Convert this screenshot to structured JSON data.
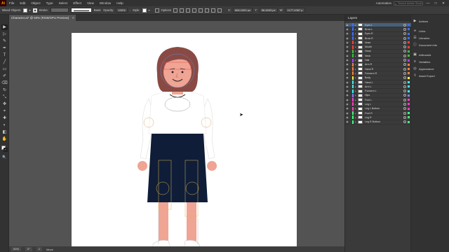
{
  "app": {
    "logo": "Ai"
  },
  "menu": [
    "File",
    "Edit",
    "Object",
    "Type",
    "Select",
    "Effect",
    "View",
    "Window",
    "Help"
  ],
  "menubar_right": {
    "workspace": "Automation",
    "search_placeholder": "Search Adobe Stock",
    "window_buttons": [
      "—",
      "□",
      "✕"
    ]
  },
  "control_bar": {
    "selection_label": "Mixed Objects",
    "stroke_label": "Stroke:",
    "brush_label": "Basic",
    "opacity_label": "Opacity:",
    "opacity_value": "100%",
    "style_label": "Style:",
    "options_label": "Options",
    "x_label": "X:",
    "x_value": "606.1002 px",
    "y_label": "Y:",
    "y_value": "96.4833 px",
    "w_label": "W:",
    "w_value": "1177.4367 p"
  },
  "tab": {
    "title": "Character.ai* @ 50% (RGB/GPU Preview)",
    "close": "✕"
  },
  "tools": [
    "▶",
    "▷",
    "✎",
    "✒",
    "T",
    "╱",
    "▭",
    "✐",
    "⌫",
    "↻",
    "⤡",
    "✥",
    "⌖",
    "✚",
    "◐",
    "◧",
    "✋",
    "🔍"
  ],
  "status_bar": {
    "zoom": "50%",
    "rotation": "0°",
    "artboard": "1",
    "tool_name": "Move"
  },
  "layers_panel": {
    "title": "Layers",
    "layers": [
      {
        "name": "Eyes L",
        "color": "#3f6fff",
        "selected": true
      },
      {
        "name": "Brow L",
        "color": "#3f6fff"
      },
      {
        "name": "Eyes R",
        "color": "#3f6fff"
      },
      {
        "name": "Brow R",
        "color": "#3f6fff"
      },
      {
        "name": "Nose",
        "color": "#ff3f3f"
      },
      {
        "name": "Mouth",
        "color": "#ff3f3f"
      },
      {
        "name": "Head",
        "color": "#3fbf3f"
      },
      {
        "name": "Neck",
        "color": "#3fbf3f"
      },
      {
        "name": "Hair",
        "color": "#b53fff"
      },
      {
        "name": "Arm R",
        "color": "#ff7f3f"
      },
      {
        "name": "Hand R",
        "color": "#ff7f3f"
      },
      {
        "name": "Forearm R",
        "color": "#ff7f3f"
      },
      {
        "name": "Body",
        "color": "#ffef3f"
      },
      {
        "name": "Hand L",
        "color": "#3fefef"
      },
      {
        "name": "Arm L",
        "color": "#3fefef"
      },
      {
        "name": "Forearm L",
        "color": "#3fefef"
      },
      {
        "name": "Hips",
        "color": "#7f7fff"
      },
      {
        "name": "Foot L",
        "color": "#ff3fbf"
      },
      {
        "name": "Leg L",
        "color": "#ff3fbf"
      },
      {
        "name": "Leg L Bottom",
        "color": "#ff3fbf"
      },
      {
        "name": "Foot R",
        "color": "#3fff7f"
      },
      {
        "name": "Leg R",
        "color": "#3fff7f"
      },
      {
        "name": "Leg R Bottom",
        "color": "#3fff7f"
      }
    ]
  },
  "dock": [
    {
      "label": "Actions",
      "icon": "▶"
    },
    {
      "label": "Links",
      "icon": "∞"
    },
    {
      "label": "Libraries",
      "icon": "☰"
    },
    {
      "label": "Document Info",
      "icon": "ⓘ"
    },
    {
      "label": "Artboards",
      "icon": "▣"
    },
    {
      "label": "Variables",
      "icon": "≡"
    },
    {
      "label": "Appearance",
      "icon": "◎"
    },
    {
      "label": "Asset Export",
      "icon": "⇪"
    }
  ],
  "colors": {
    "skirt": "#0f1d38",
    "skin": "#f0a494",
    "hair": "#8a4a44",
    "shirt": "#ffffff",
    "shoe": "#0f1d38"
  }
}
